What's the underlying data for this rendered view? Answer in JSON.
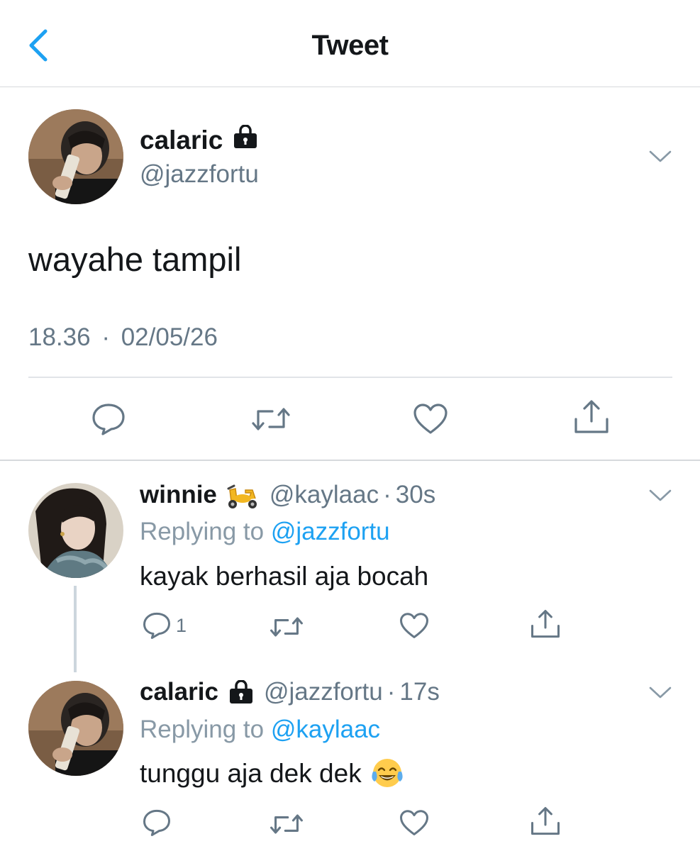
{
  "header": {
    "title": "Tweet"
  },
  "main_tweet": {
    "name": "calaric",
    "handle": "@jazzfortu",
    "text": "wayahe tampil",
    "time": "18.36",
    "separator": "·",
    "date": "02/05/26"
  },
  "replies": [
    {
      "name": "winnie",
      "name_emoji": "scooter-emoji",
      "handle": "@kaylaac",
      "separator": "·",
      "time": "30s",
      "replying_prefix": "Replying to",
      "replying_to": "@jazzfortu",
      "text": "kayak berhasil aja bocah",
      "reply_count": "1"
    },
    {
      "name": "calaric",
      "handle": "@jazzfortu",
      "separator": "·",
      "time": "17s",
      "replying_prefix": "Replying to",
      "replying_to": "@kaylaac",
      "text": "tunggu aja dek dek",
      "text_emoji": "tears-of-joy-emoji"
    }
  ],
  "icons": [
    "back-arrow-icon",
    "lock-icon",
    "chevron-down-icon",
    "reply-icon",
    "retweet-icon",
    "like-icon",
    "share-icon"
  ],
  "colors": {
    "accent": "#1da1f2",
    "text": "#14171a",
    "secondary": "#657786",
    "divider": "#e1e4e8",
    "thread_line": "#ccd6dd"
  }
}
